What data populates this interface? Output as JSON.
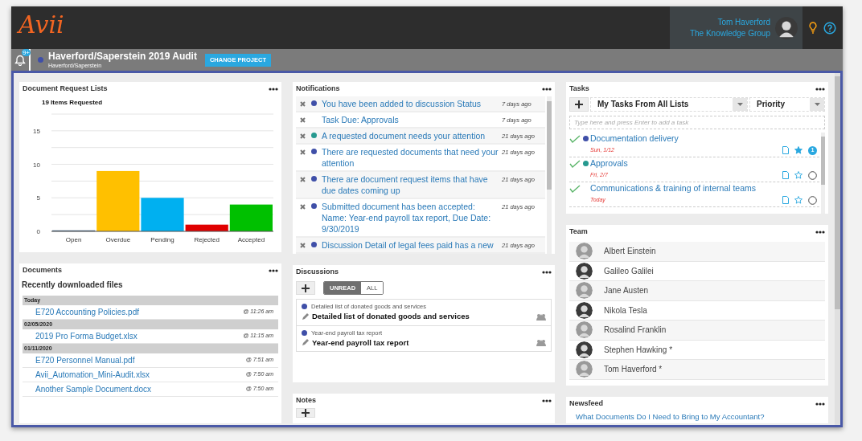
{
  "header": {
    "logo": "Avii",
    "user_name": "Tom Haverford",
    "organization": "The Knowledge Group",
    "alert_count": "9+"
  },
  "project": {
    "title": "Haverford/Saperstein 2019 Audit",
    "subtitle": "Haverford/Saperstein",
    "color": "#3f4fa8",
    "button": "CHANGE PROJECT"
  },
  "document_requests": {
    "title": "Document Request Lists",
    "chart_data": {
      "type": "bar",
      "title": "19 Items Requested",
      "categories": [
        "Open",
        "Overdue",
        "Pending",
        "Rejected",
        "Accepted"
      ],
      "series": [
        {
          "values": [
            0,
            9,
            5,
            1,
            4
          ]
        }
      ],
      "grid": true,
      "colors": [
        "#3b5b7a",
        "#ffc000",
        "#00b0f0",
        "#e00000",
        "#00c000"
      ],
      "ylim": [
        0,
        17.5
      ],
      "yticks": [
        0,
        5,
        10,
        15
      ]
    }
  },
  "notifications": {
    "title": "Notifications",
    "items": [
      {
        "text": "You have been added to discussion Status",
        "time": "7 days ago",
        "color": "#3f4fa8"
      },
      {
        "text": "Task Due: Approvals",
        "time": "7 days ago"
      },
      {
        "text": "A requested document needs your attention",
        "time": "21 days ago",
        "color": "#26998f"
      },
      {
        "text": "There are requested documents that need your attention",
        "time": "21 days ago",
        "color": "#3f4fa8"
      },
      {
        "text": "There are document request items that have due dates coming up",
        "time": "21 days ago",
        "color": "#3f4fa8"
      },
      {
        "text": "Submitted document has been accepted: Name: Year-end payroll tax report, Due Date: 9/30/2019",
        "time": "21 days ago",
        "color": "#3f4fa8"
      },
      {
        "text": "Discussion Detail of legal fees paid has a new",
        "time": "21 days ago",
        "color": "#3f4fa8"
      }
    ]
  },
  "tasks": {
    "title": "Tasks",
    "list_filter": "My Tasks From All Lists",
    "sort": "Priority",
    "placeholder": "Type here and press Enter to add a task",
    "items": [
      {
        "title": "Documentation delivery",
        "due": "Sun, 1/12",
        "color": "#3f4fa8",
        "starred": true,
        "count": "1"
      },
      {
        "title": "Approvals",
        "due": "Fri, 2/7",
        "color": "#26998f",
        "starred": false
      },
      {
        "title": "Communications & training of internal teams",
        "due": "Today",
        "starred": false
      }
    ]
  },
  "team": {
    "title": "Team",
    "members": [
      "Albert Einstein",
      "Galileo Galilei",
      "Jane Austen",
      "Nikola Tesla",
      "Rosalind Franklin",
      "Stephen Hawking *",
      "Tom Haverford *"
    ]
  },
  "documents": {
    "title": "Documents",
    "heading": "Recently downloaded files",
    "groups": [
      {
        "label": "Today",
        "files": [
          {
            "name": "E720 Accounting Policies.pdf",
            "time": "@ 11:26 am"
          }
        ]
      },
      {
        "label": "02/05/2020",
        "files": [
          {
            "name": "2019 Pro Forma Budget.xlsx",
            "time": "@ 11:15 am"
          }
        ]
      },
      {
        "label": "01/11/2020",
        "files": [
          {
            "name": "E720 Personnel Manual.pdf",
            "time": "@ 7:51 am"
          },
          {
            "name": "Avii_Automation_Mini-Audit.xlsx",
            "time": "@ 7:50 am"
          },
          {
            "name": "Another Sample Document.docx",
            "time": "@ 7:50 am"
          }
        ]
      }
    ]
  },
  "discussions": {
    "title": "Discussions",
    "filters": [
      {
        "label": "UNREAD",
        "selected": true
      },
      {
        "label": "ALL",
        "selected": false
      }
    ],
    "items": [
      {
        "topic": "Detailed list of donated goods and services",
        "title": "Detailed list of donated goods and services",
        "color": "#3f4fa8"
      },
      {
        "topic": "Year-end payroll tax report",
        "title": "Year-end payroll tax report",
        "color": "#3f4fa8"
      }
    ]
  },
  "notes": {
    "title": "Notes"
  },
  "newsfeed": {
    "title": "Newsfeed",
    "items": [
      "What Documents Do I Need to Bring to My Accountant?"
    ]
  }
}
